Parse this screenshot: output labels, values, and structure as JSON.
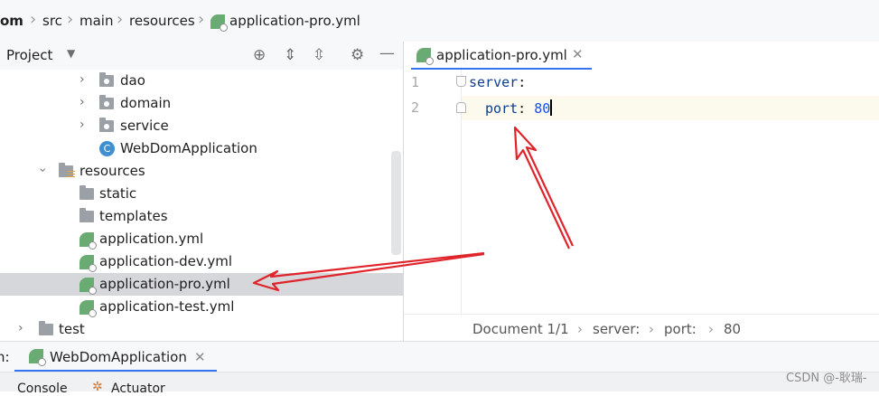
{
  "breadcrumb": {
    "items": [
      "om",
      "src",
      "main",
      "resources",
      "application-pro.yml"
    ]
  },
  "project_panel": {
    "title": "Project",
    "tree": [
      {
        "label": "dao",
        "type": "package",
        "collapsed": true
      },
      {
        "label": "domain",
        "type": "package",
        "collapsed": true
      },
      {
        "label": "service",
        "type": "package",
        "collapsed": true
      },
      {
        "label": "WebDomApplication",
        "type": "class"
      },
      {
        "label": "resources",
        "type": "resources-folder",
        "expanded": true
      },
      {
        "label": "static",
        "type": "folder"
      },
      {
        "label": "templates",
        "type": "folder"
      },
      {
        "label": "application.yml",
        "type": "yml"
      },
      {
        "label": "application-dev.yml",
        "type": "yml"
      },
      {
        "label": "application-pro.yml",
        "type": "yml",
        "selected": true
      },
      {
        "label": "application-test.yml",
        "type": "yml"
      },
      {
        "label": "test",
        "type": "folder",
        "collapsed": true
      }
    ]
  },
  "editor": {
    "tab_label": "application-pro.yml",
    "lines": [
      {
        "number": "1",
        "key": "server",
        "colon": ":",
        "value": ""
      },
      {
        "number": "2",
        "key": "port",
        "colon": ": ",
        "value": "80"
      }
    ],
    "status": {
      "document": "Document 1/1",
      "path1": "server:",
      "path2": "port:",
      "path3": "80"
    }
  },
  "run_bar": {
    "prefix": "n:",
    "config_label": "WebDomApplication"
  },
  "bottom_tabs": {
    "console": "Console",
    "actuator": "Actuator"
  },
  "watermark": "CSDN @-耿瑞-",
  "colors": {
    "selected_row": "#d5d7db",
    "yaml_key": "#0b3d91",
    "yaml_number": "#1750eb",
    "annotation_arrow": "#e0242b",
    "current_line": "#fcfaed"
  }
}
